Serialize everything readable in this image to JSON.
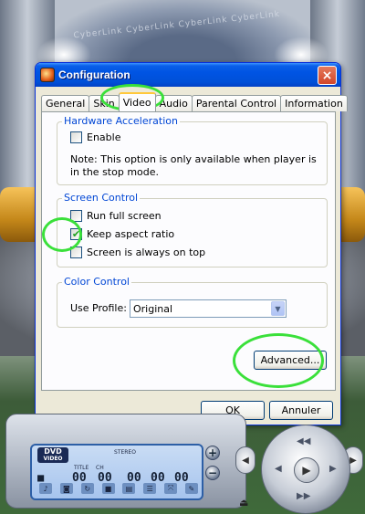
{
  "background": {
    "arch_text": "CyberLink CyberLink CyberLink CyberLink"
  },
  "dialog": {
    "title": "Configuration",
    "close_icon": "×",
    "tabs": [
      {
        "label": "General",
        "active": false
      },
      {
        "label": "Skin",
        "active": false
      },
      {
        "label": "Video",
        "active": true
      },
      {
        "label": "Audio",
        "active": false
      },
      {
        "label": "Parental Control",
        "active": false
      },
      {
        "label": "Information",
        "active": false
      }
    ],
    "hardware_acceleration": {
      "title": "Hardware Acceleration",
      "enable_label": "Enable",
      "enable_checked": false,
      "note": "Note: This option is only available when player is in the stop mode."
    },
    "screen_control": {
      "title": "Screen Control",
      "options": [
        {
          "label": "Run full screen",
          "checked": false
        },
        {
          "label": "Keep aspect ratio",
          "checked": true
        },
        {
          "label": "Screen is always on top",
          "checked": false
        }
      ]
    },
    "color_control": {
      "title": "Color Control",
      "use_profile_label": "Use Profile:",
      "profile_value": "Original"
    },
    "advanced_button": "Advanced...",
    "ok_button": "OK",
    "cancel_button": "Annuler"
  },
  "player": {
    "logo_top": "DVD",
    "logo_bottom": "VIDEO",
    "labels": {
      "title": "TITLE",
      "ch": "CH",
      "stereo": "STEREO"
    },
    "digits": {
      "title": "00",
      "ch": "00",
      "h": "00",
      "m": "00",
      "s": "00"
    },
    "icons": [
      "disc-icon",
      "camera-icon",
      "repeat-icon",
      "stop-icon",
      "subtitle-icon",
      "menu-icon",
      "fullscreen-icon",
      "tools-icon"
    ],
    "icon_glyphs": [
      "♪",
      "◙",
      "↻",
      "■",
      "▤",
      "☰",
      "⤧",
      "✎"
    ],
    "volume_up": "+",
    "volume_down": "−",
    "nav_glyphs": {
      "center": "▶",
      "up": "◀◀",
      "left": "◀",
      "right": "▶",
      "down": "▶▶"
    },
    "side_glyphs": {
      "left": "◀",
      "right": "▶"
    },
    "eject": "⏏"
  }
}
